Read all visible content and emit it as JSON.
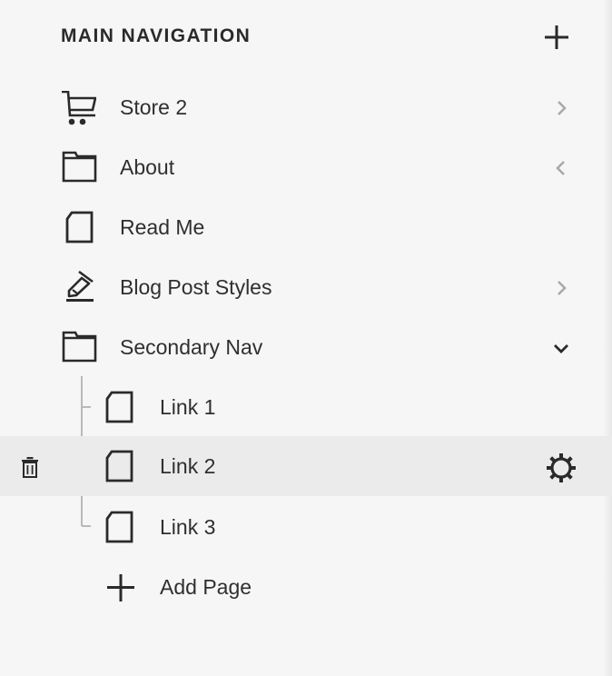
{
  "header": {
    "title": "MAIN NAVIGATION",
    "add_icon": "plus-icon"
  },
  "nav_items": [
    {
      "label": "Store 2",
      "icon": "cart-icon",
      "indicator": "chevron-right-icon"
    },
    {
      "label": "About",
      "icon": "folder-icon",
      "indicator": "chevron-left-icon"
    },
    {
      "label": "Read Me",
      "icon": "page-icon"
    },
    {
      "label": "Blog Post Styles",
      "icon": "blog-pen-icon",
      "indicator": "chevron-right-icon"
    },
    {
      "label": "Secondary Nav",
      "icon": "folder-icon",
      "indicator": "chevron-down-icon",
      "children": [
        {
          "label": "Link 1",
          "icon": "page-icon"
        },
        {
          "label": "Link 2",
          "icon": "page-icon",
          "selected": true,
          "actions": [
            "trash-icon",
            "gear-icon"
          ]
        },
        {
          "label": "Link 3",
          "icon": "page-icon"
        }
      ]
    }
  ],
  "add_page": {
    "label": "Add Page",
    "icon": "plus-icon"
  },
  "colors": {
    "background": "#f6f6f6",
    "selected_row": "#ebebeb",
    "text": "#2a2a2a",
    "muted_chevron": "#a8a8a8",
    "tree_lines": "#b9b9b9"
  }
}
